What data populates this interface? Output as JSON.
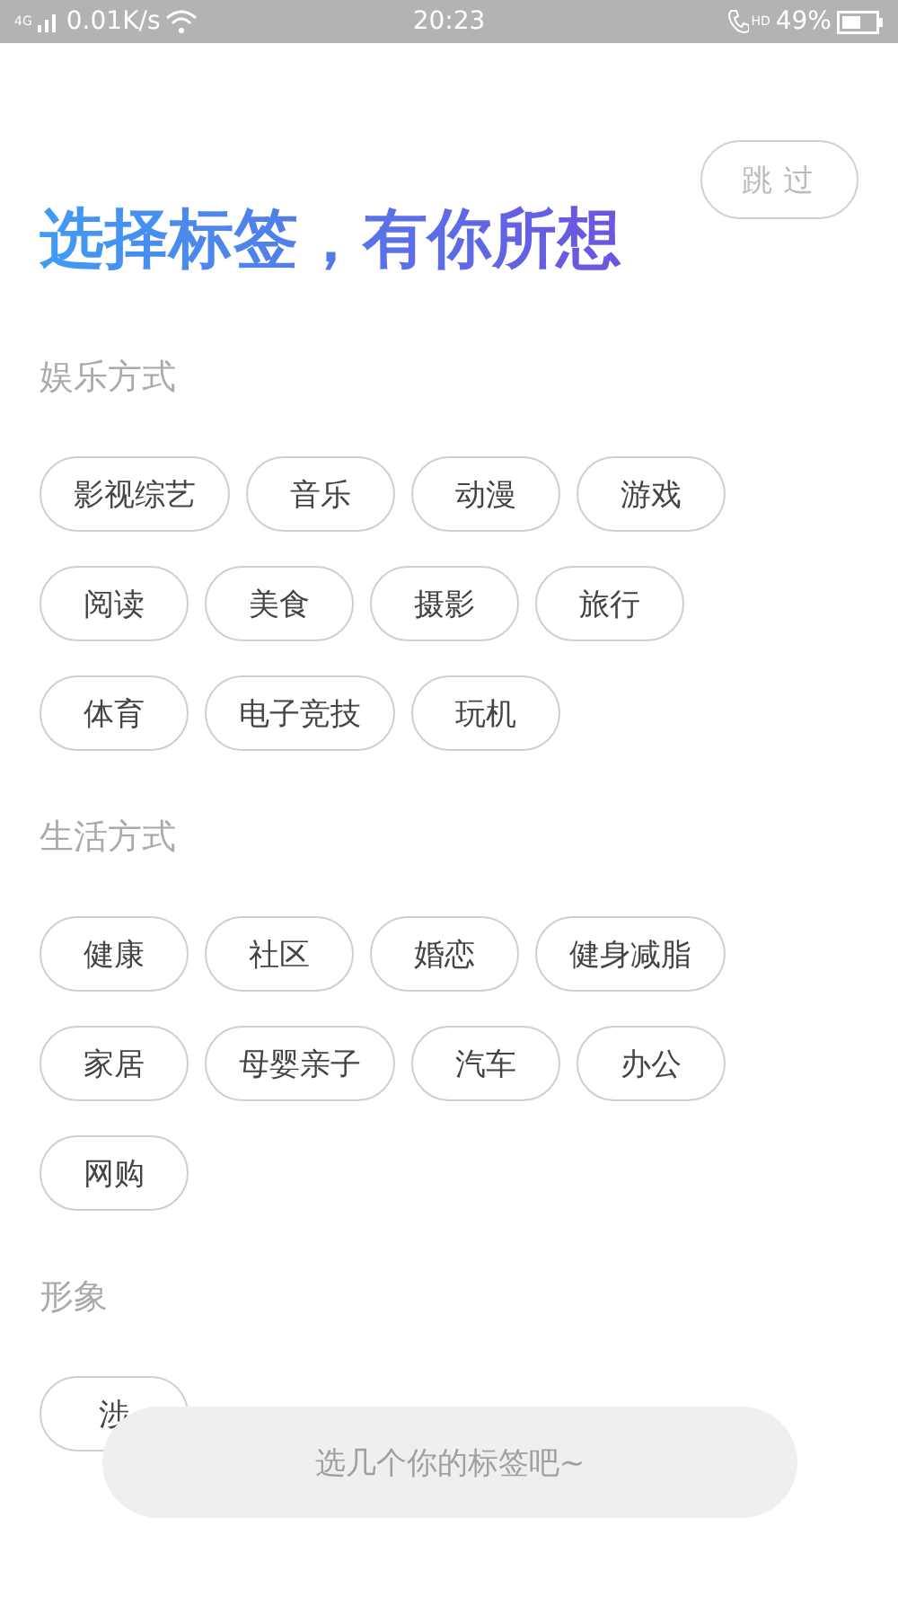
{
  "status_bar": {
    "network": "4G",
    "speed": "0.01K/s",
    "time": "20:23",
    "call_badge": "HD",
    "battery": "49%"
  },
  "skip_button": "跳过",
  "title": "选择标签，有你所想",
  "sections": [
    {
      "heading": "娱乐方式",
      "tags": [
        {
          "label": "影视综艺"
        },
        {
          "label": "音乐"
        },
        {
          "label": "动漫"
        },
        {
          "label": "游戏"
        },
        {
          "label": "阅读"
        },
        {
          "label": "美食"
        },
        {
          "label": "摄影"
        },
        {
          "label": "旅行"
        },
        {
          "label": "体育"
        },
        {
          "label": "电子竞技"
        },
        {
          "label": "玩机"
        }
      ]
    },
    {
      "heading": "生活方式",
      "tags": [
        {
          "label": "健康"
        },
        {
          "label": "社区"
        },
        {
          "label": "婚恋"
        },
        {
          "label": "健身减脂"
        },
        {
          "label": "家居"
        },
        {
          "label": "母婴亲子"
        },
        {
          "label": "汽车"
        },
        {
          "label": "办公"
        },
        {
          "label": "网购"
        }
      ]
    },
    {
      "heading": "形象",
      "tags": [
        {
          "label": "涉"
        }
      ]
    }
  ],
  "toast": "选几个你的标签吧~"
}
